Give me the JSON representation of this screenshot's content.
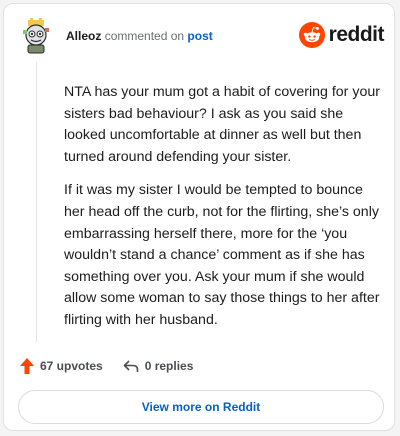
{
  "header": {
    "username": "Alleoz",
    "commented_text": "commented on",
    "post_link": "post",
    "brand_name": "reddit"
  },
  "comment": {
    "paragraphs": [
      "NTA has your mum got a habit of covering for your sisters bad behaviour? I ask as you said she looked uncomfortable at dinner as well but then turned around defending your sister.",
      "If it was my sister I would be tempted to bounce her head off the curb, not for the flirting, she’s only embarrassing herself there, more for the ‘you wouldn’t stand a chance’ comment as if she has something over you. Ask your mum if she would allow some woman to say those things to her after flirting with her husband."
    ]
  },
  "actions": {
    "upvotes": "67 upvotes",
    "replies": "0 replies"
  },
  "footer": {
    "view_more": "View more on Reddit"
  },
  "colors": {
    "brand": "#ff4500",
    "link": "#0a5fc7",
    "upvote": "#ff4500"
  }
}
